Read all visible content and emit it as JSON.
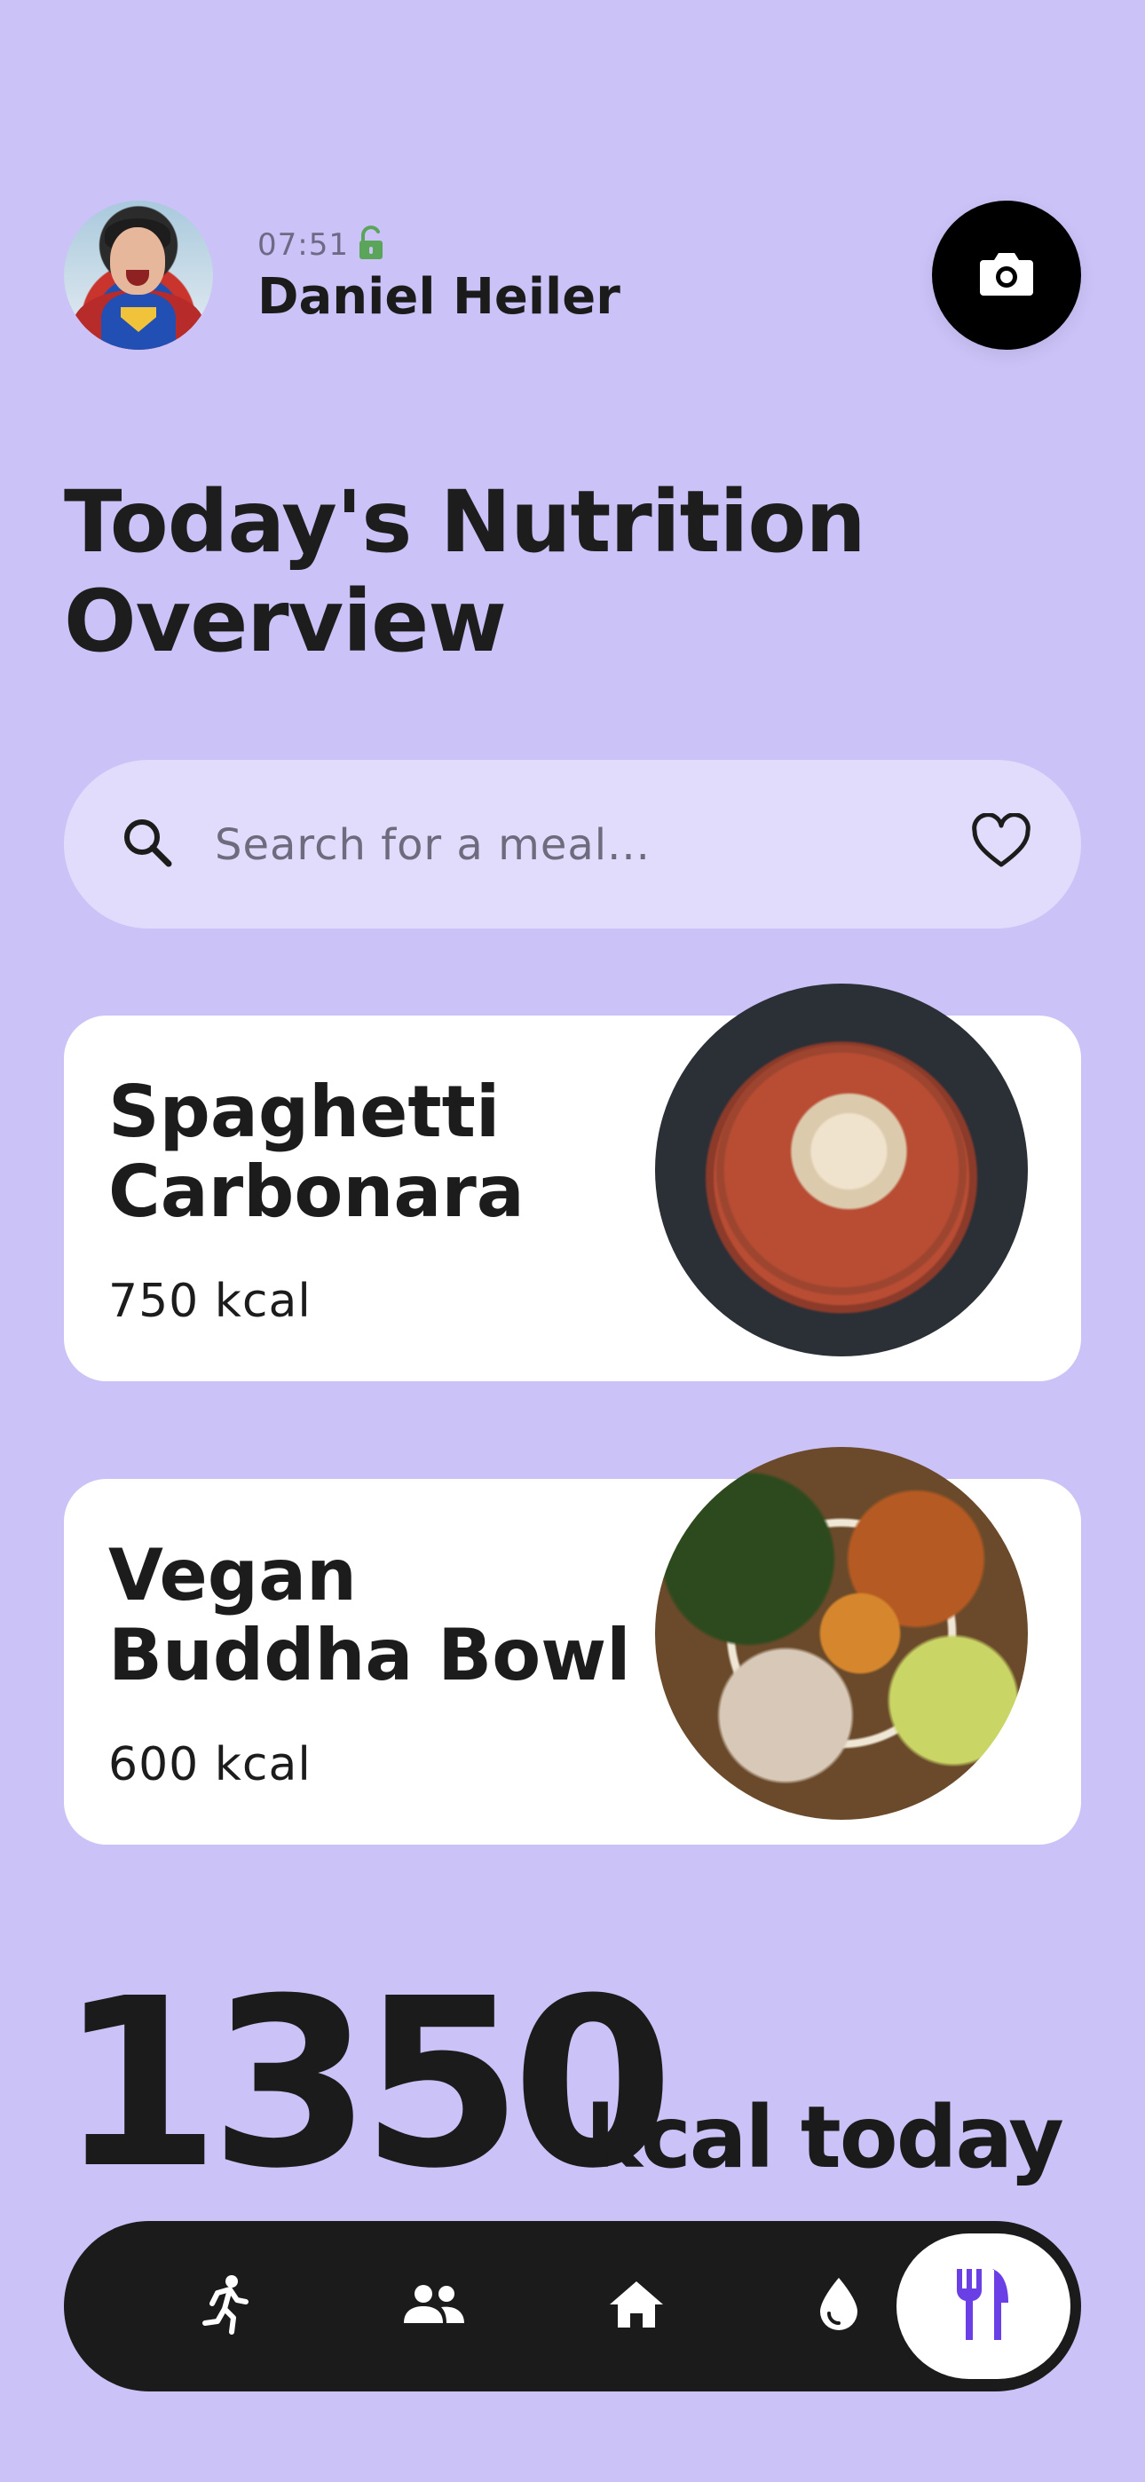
{
  "header": {
    "time": "07:51",
    "user_name": "Daniel Heiler",
    "avatar_icon": "superman-avatar",
    "lock_icon": "lock-open-icon",
    "camera_icon": "camera-icon"
  },
  "title": {
    "line1": "Today's Nutrition",
    "line2": "Overview"
  },
  "search": {
    "placeholder": "Search for a meal...",
    "value": "",
    "search_icon": "search-icon",
    "favorite_icon": "heart-outline-icon"
  },
  "meals": [
    {
      "name_line1": "Spaghetti",
      "name_line2": "Carbonara",
      "kcal": "750 kcal"
    },
    {
      "name_line1": "Vegan",
      "name_line2": "Buddha Bowl",
      "kcal": "600 kcal"
    }
  ],
  "summary": {
    "total": "1350",
    "label": "kcal today"
  },
  "nav": {
    "items": [
      {
        "icon": "running-icon",
        "active": false
      },
      {
        "icon": "people-icon",
        "active": false
      },
      {
        "icon": "home-icon",
        "active": false
      },
      {
        "icon": "water-drop-icon",
        "active": false
      },
      {
        "icon": "fork-knife-icon",
        "active": true
      }
    ]
  },
  "colors": {
    "background": "#cbc2f7",
    "search_background": "#e1dcfb",
    "card": "#ffffff",
    "nav_background": "#1b1b1b",
    "accent_purple": "#6a3fe6",
    "lock_green": "#5aa55a"
  }
}
